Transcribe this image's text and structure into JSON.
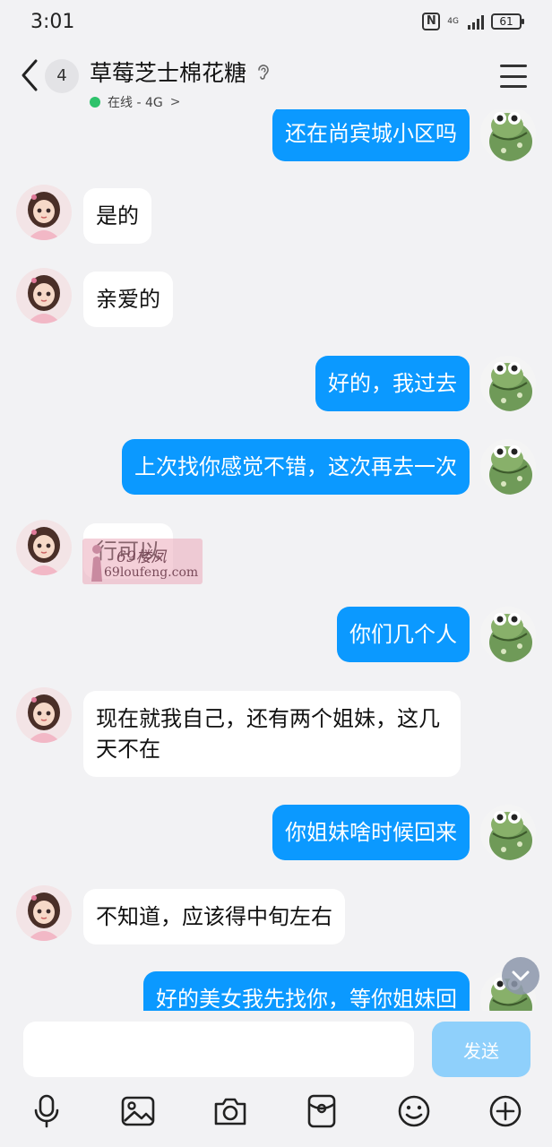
{
  "status_bar": {
    "time": "3:01",
    "network": "4G",
    "battery": "61"
  },
  "header": {
    "back_count": "4",
    "title": "草莓芝士棉花糖",
    "status_text": "在线 - 4G",
    "status_chevron": ">"
  },
  "messages": [
    {
      "side": "out",
      "text": "还在尚宾城小区吗"
    },
    {
      "side": "in",
      "text": "是的"
    },
    {
      "side": "in",
      "text": "亲爱的"
    },
    {
      "side": "out",
      "text": "好的，我过去"
    },
    {
      "side": "out",
      "text": "上次找你感觉不错，这次再去一次"
    },
    {
      "side": "in",
      "text": "行可以"
    },
    {
      "side": "out",
      "text": "你们几个人"
    },
    {
      "side": "in",
      "text": "现在就我自己，还有两个姐妹，这几天不在"
    },
    {
      "side": "out",
      "text": "你姐妹啥时候回来"
    },
    {
      "side": "in",
      "text": "不知道，应该得中旬左右"
    },
    {
      "side": "out",
      "text": "好的美女我先找你，等你姐妹回"
    }
  ],
  "watermark": {
    "site": "69loufeng.com",
    "brand": "69楼凤"
  },
  "input": {
    "placeholder": "",
    "send_label": "发送"
  },
  "toolbar": {
    "icons": [
      "microphone-icon",
      "image-icon",
      "camera-icon",
      "red-packet-icon",
      "emoji-icon",
      "plus-icon"
    ]
  },
  "colors": {
    "outgoing_bubble": "#0b99ff",
    "incoming_bubble": "#ffffff",
    "background": "#f2f2f4",
    "send_button": "#8fd0fb",
    "online": "#2ec26b"
  }
}
